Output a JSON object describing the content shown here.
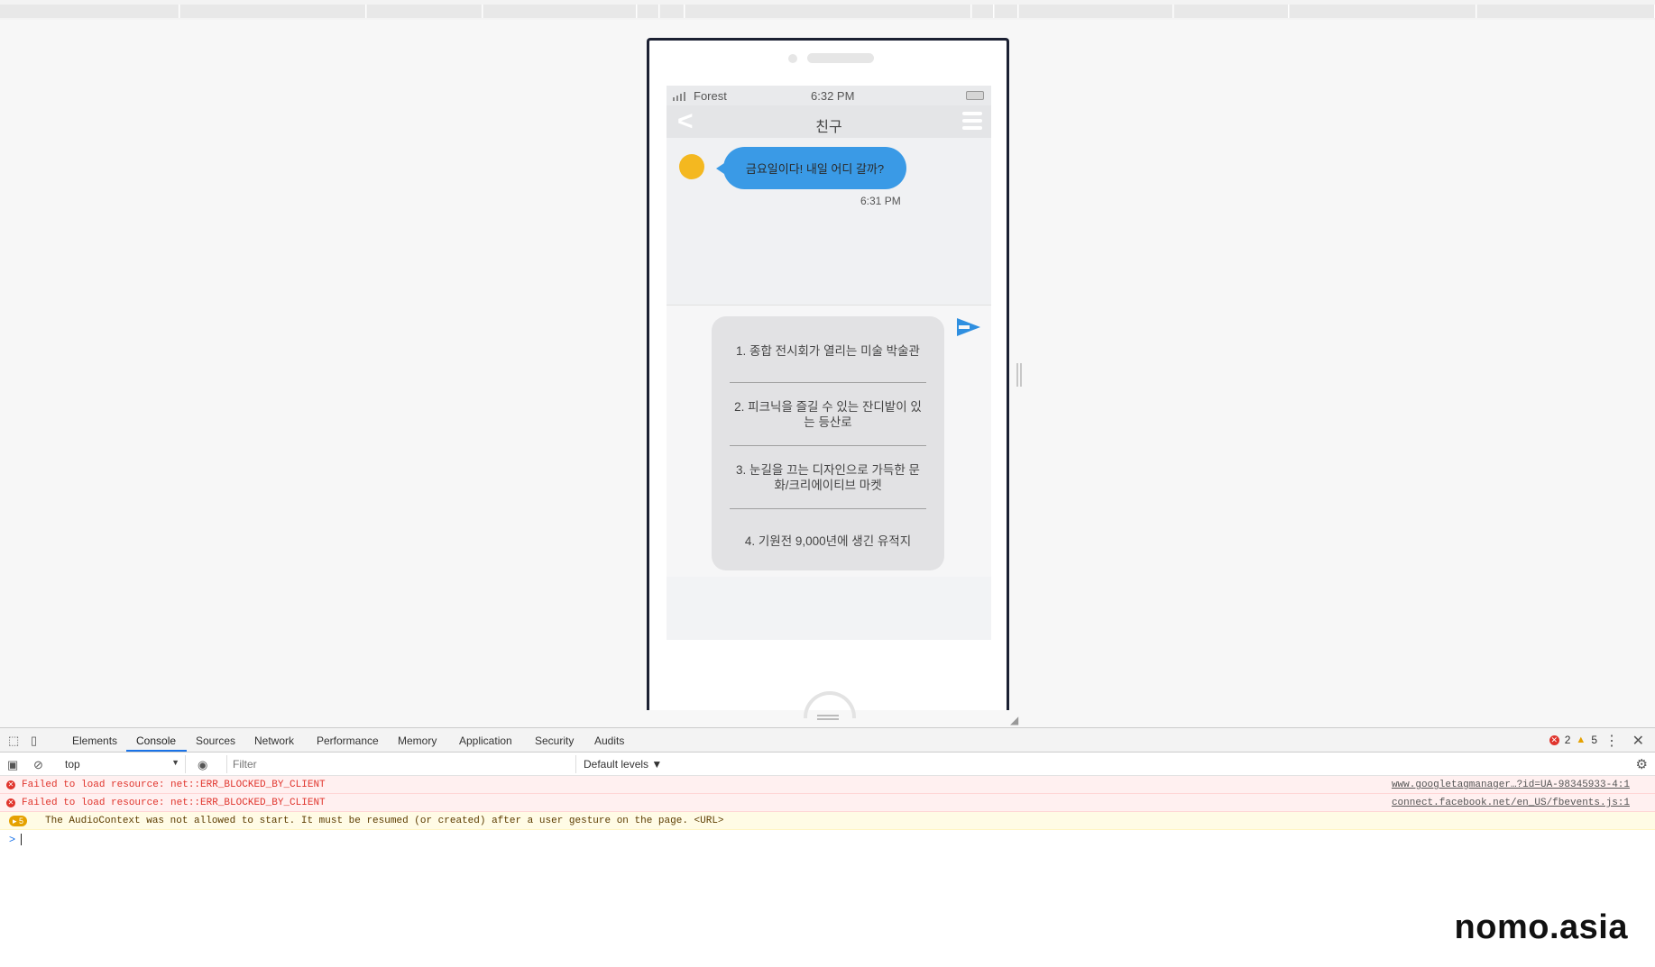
{
  "phone": {
    "status_carrier": "Forest",
    "status_time": "6:32 PM",
    "nav_title": "친구",
    "back_glyph": "<",
    "message": {
      "text": "금요일이다! 내일 어디 갈까?",
      "time": "6:31 PM"
    },
    "options": [
      "1. 종합 전시회가 열리는 미술 박술관",
      "2. 피크닉을 즐길 수 있는 잔디밭이 있는 등산로",
      "3. 눈길을 끄는 디자인으로 가득한 문화/크리에이티브 마켓",
      "4. 기원전 9,000년에 생긴 유적지"
    ],
    "icons": {
      "send": "send-arrow-icon",
      "menu": "hamburger-menu-icon",
      "back": "chevron-left-icon"
    },
    "colors": {
      "bubble": "#3a9ae6",
      "avatar": "#f4b820",
      "send": "#2f8fe0"
    }
  },
  "devtools": {
    "tabs": [
      "Elements",
      "Console",
      "Sources",
      "Network",
      "Performance",
      "Memory",
      "Application",
      "Security",
      "Audits"
    ],
    "active_tab": "Console",
    "error_count": "2",
    "warning_count": "5",
    "context": "top",
    "filter_placeholder": "Filter",
    "levels_label": "Default levels ▼",
    "logs": [
      {
        "type": "error",
        "text": "Failed to load resource: net::ERR_BLOCKED_BY_CLIENT",
        "source": "www.googletagmanager…?id=UA-98345933-4:1"
      },
      {
        "type": "error",
        "text": "Failed to load resource: net::ERR_BLOCKED_BY_CLIENT",
        "source": "connect.facebook.net/en_US/fbevents.js:1"
      },
      {
        "type": "warning",
        "badge": "5",
        "text": "The AudioContext was not allowed to start. It must be resumed (or created) after a user gesture on the page. <URL>"
      }
    ],
    "prompt_glyph": ">"
  },
  "watermark": "nomo.asia"
}
